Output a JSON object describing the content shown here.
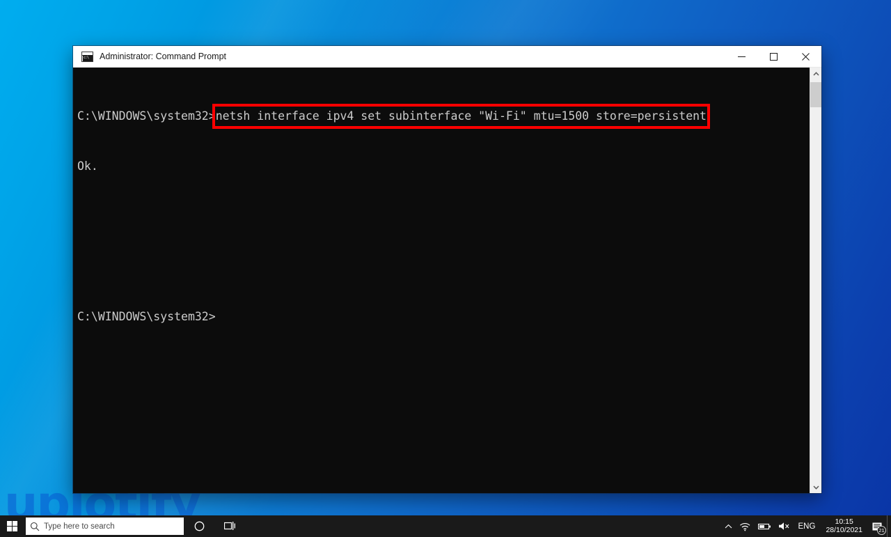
{
  "desktop": {
    "wallpaper_color_left": "#00ADEF",
    "wallpaper_color_right": "#0A35A6",
    "watermark_text": "uplotify",
    "watermark_color": "#0A5AD2"
  },
  "window": {
    "title": "Administrator: Command Prompt",
    "icon_name": "command-prompt-icon",
    "background_color": "#0C0C0C",
    "text_color": "#CCCCCC",
    "titlebar_background": "#FFFFFF",
    "buttons": {
      "minimize_label": "Minimize",
      "maximize_label": "Maximize",
      "close_label": "Close"
    }
  },
  "console": {
    "lines": [
      {
        "id": "line-prompt-command",
        "prompt": "C:\\WINDOWS\\system32>",
        "command": "netsh interface ipv4 set subinterface \"Wi-Fi\" mtu=1500 store=persistent",
        "highlighted": true
      },
      {
        "id": "line-output",
        "text": "Ok."
      },
      {
        "id": "line-blank-1",
        "text": ""
      },
      {
        "id": "line-blank-2",
        "text": ""
      },
      {
        "id": "line-prompt-idle",
        "text": "C:\\WINDOWS\\system32>"
      }
    ],
    "highlight_color": "#FF0000",
    "cursor_after_prompt": true
  },
  "scrollbar": {
    "up_arrow_name": "scroll-up-arrow",
    "down_arrow_name": "scroll-down-arrow",
    "thumb_position": "top"
  },
  "taskbar": {
    "background_color": "#1A1A1A",
    "start_label": "Start",
    "search": {
      "placeholder": "Type here to search",
      "value": ""
    },
    "cortana_label": "Cortana",
    "taskview_label": "Task View",
    "tray": {
      "overflow_label": "Show hidden icons",
      "network_label": "Wi-Fi",
      "battery_label": "Battery",
      "volume_label": "Volume muted",
      "language": "ENG",
      "time": "10:15",
      "date": "28/10/2021",
      "notification_count": "21"
    }
  }
}
